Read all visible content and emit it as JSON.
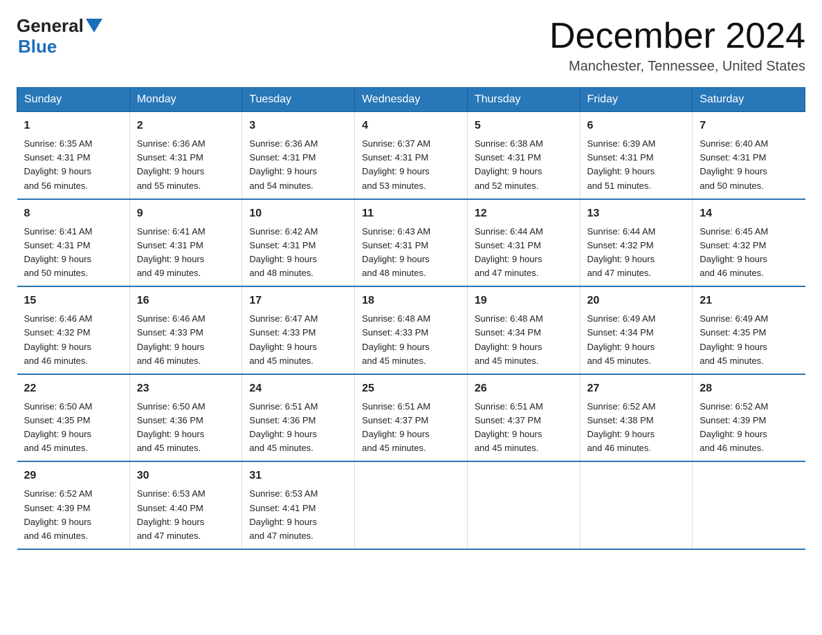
{
  "logo": {
    "general": "General",
    "blue": "Blue"
  },
  "header": {
    "month_title": "December 2024",
    "location": "Manchester, Tennessee, United States"
  },
  "days_of_week": [
    "Sunday",
    "Monday",
    "Tuesday",
    "Wednesday",
    "Thursday",
    "Friday",
    "Saturday"
  ],
  "weeks": [
    [
      {
        "day": "1",
        "sunrise": "6:35 AM",
        "sunset": "4:31 PM",
        "daylight": "9 hours and 56 minutes."
      },
      {
        "day": "2",
        "sunrise": "6:36 AM",
        "sunset": "4:31 PM",
        "daylight": "9 hours and 55 minutes."
      },
      {
        "day": "3",
        "sunrise": "6:36 AM",
        "sunset": "4:31 PM",
        "daylight": "9 hours and 54 minutes."
      },
      {
        "day": "4",
        "sunrise": "6:37 AM",
        "sunset": "4:31 PM",
        "daylight": "9 hours and 53 minutes."
      },
      {
        "day": "5",
        "sunrise": "6:38 AM",
        "sunset": "4:31 PM",
        "daylight": "9 hours and 52 minutes."
      },
      {
        "day": "6",
        "sunrise": "6:39 AM",
        "sunset": "4:31 PM",
        "daylight": "9 hours and 51 minutes."
      },
      {
        "day": "7",
        "sunrise": "6:40 AM",
        "sunset": "4:31 PM",
        "daylight": "9 hours and 50 minutes."
      }
    ],
    [
      {
        "day": "8",
        "sunrise": "6:41 AM",
        "sunset": "4:31 PM",
        "daylight": "9 hours and 50 minutes."
      },
      {
        "day": "9",
        "sunrise": "6:41 AM",
        "sunset": "4:31 PM",
        "daylight": "9 hours and 49 minutes."
      },
      {
        "day": "10",
        "sunrise": "6:42 AM",
        "sunset": "4:31 PM",
        "daylight": "9 hours and 48 minutes."
      },
      {
        "day": "11",
        "sunrise": "6:43 AM",
        "sunset": "4:31 PM",
        "daylight": "9 hours and 48 minutes."
      },
      {
        "day": "12",
        "sunrise": "6:44 AM",
        "sunset": "4:31 PM",
        "daylight": "9 hours and 47 minutes."
      },
      {
        "day": "13",
        "sunrise": "6:44 AM",
        "sunset": "4:32 PM",
        "daylight": "9 hours and 47 minutes."
      },
      {
        "day": "14",
        "sunrise": "6:45 AM",
        "sunset": "4:32 PM",
        "daylight": "9 hours and 46 minutes."
      }
    ],
    [
      {
        "day": "15",
        "sunrise": "6:46 AM",
        "sunset": "4:32 PM",
        "daylight": "9 hours and 46 minutes."
      },
      {
        "day": "16",
        "sunrise": "6:46 AM",
        "sunset": "4:33 PM",
        "daylight": "9 hours and 46 minutes."
      },
      {
        "day": "17",
        "sunrise": "6:47 AM",
        "sunset": "4:33 PM",
        "daylight": "9 hours and 45 minutes."
      },
      {
        "day": "18",
        "sunrise": "6:48 AM",
        "sunset": "4:33 PM",
        "daylight": "9 hours and 45 minutes."
      },
      {
        "day": "19",
        "sunrise": "6:48 AM",
        "sunset": "4:34 PM",
        "daylight": "9 hours and 45 minutes."
      },
      {
        "day": "20",
        "sunrise": "6:49 AM",
        "sunset": "4:34 PM",
        "daylight": "9 hours and 45 minutes."
      },
      {
        "day": "21",
        "sunrise": "6:49 AM",
        "sunset": "4:35 PM",
        "daylight": "9 hours and 45 minutes."
      }
    ],
    [
      {
        "day": "22",
        "sunrise": "6:50 AM",
        "sunset": "4:35 PM",
        "daylight": "9 hours and 45 minutes."
      },
      {
        "day": "23",
        "sunrise": "6:50 AM",
        "sunset": "4:36 PM",
        "daylight": "9 hours and 45 minutes."
      },
      {
        "day": "24",
        "sunrise": "6:51 AM",
        "sunset": "4:36 PM",
        "daylight": "9 hours and 45 minutes."
      },
      {
        "day": "25",
        "sunrise": "6:51 AM",
        "sunset": "4:37 PM",
        "daylight": "9 hours and 45 minutes."
      },
      {
        "day": "26",
        "sunrise": "6:51 AM",
        "sunset": "4:37 PM",
        "daylight": "9 hours and 45 minutes."
      },
      {
        "day": "27",
        "sunrise": "6:52 AM",
        "sunset": "4:38 PM",
        "daylight": "9 hours and 46 minutes."
      },
      {
        "day": "28",
        "sunrise": "6:52 AM",
        "sunset": "4:39 PM",
        "daylight": "9 hours and 46 minutes."
      }
    ],
    [
      {
        "day": "29",
        "sunrise": "6:52 AM",
        "sunset": "4:39 PM",
        "daylight": "9 hours and 46 minutes."
      },
      {
        "day": "30",
        "sunrise": "6:53 AM",
        "sunset": "4:40 PM",
        "daylight": "9 hours and 47 minutes."
      },
      {
        "day": "31",
        "sunrise": "6:53 AM",
        "sunset": "4:41 PM",
        "daylight": "9 hours and 47 minutes."
      },
      null,
      null,
      null,
      null
    ]
  ],
  "labels": {
    "sunrise": "Sunrise:",
    "sunset": "Sunset:",
    "daylight": "Daylight:"
  }
}
